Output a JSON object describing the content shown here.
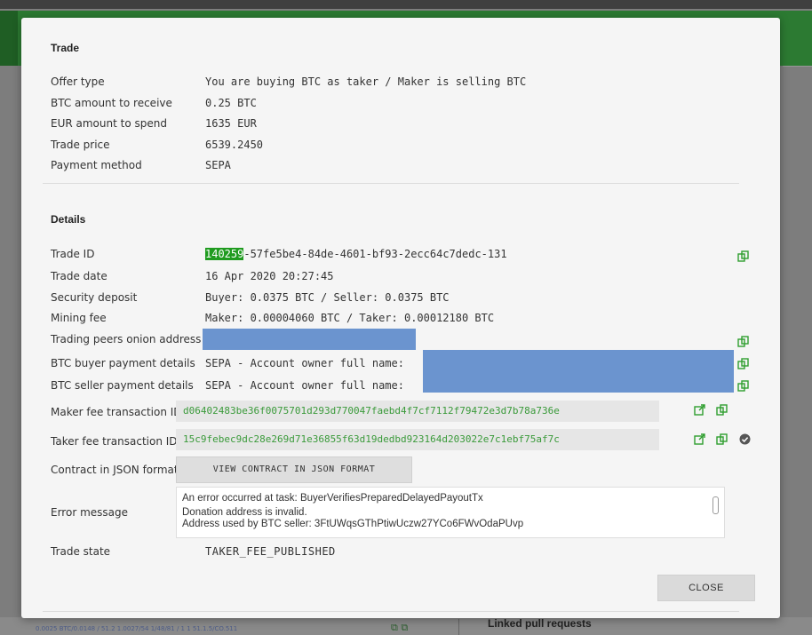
{
  "background": {
    "linked_label": "Linked pull requests",
    "bottom_text": "0.0025 BTC/0.0148 / 51.2 1.0027/54 1/48/81 / 1 1 51.1.5/CO.511"
  },
  "trade": {
    "title": "Trade",
    "rows": [
      {
        "label": "Offer type",
        "value": "You are buying BTC as taker / Maker is selling BTC"
      },
      {
        "label": "BTC amount to receive",
        "value": "0.25 BTC"
      },
      {
        "label": "EUR amount to spend",
        "value": "1635 EUR"
      },
      {
        "label": "Trade price",
        "value": "6539.2450"
      },
      {
        "label": "Payment method",
        "value": "SEPA"
      }
    ]
  },
  "details": {
    "title": "Details",
    "trade_id_label": "Trade ID",
    "trade_id_highlight": "140259",
    "trade_id_rest": "-57fe5be4-84de-4601-bf93-2ecc64c7dedc-131",
    "trade_date_label": "Trade date",
    "trade_date": "16 Apr 2020 20:27:45",
    "security_deposit_label": "Security deposit",
    "security_deposit": "Buyer: 0.0375 BTC / Seller: 0.0375 BTC",
    "mining_fee_label": "Mining fee",
    "mining_fee": "Maker: 0.00004060 BTC / Taker: 0.00012180 BTC",
    "onion_label": "Trading peers onion address",
    "buyer_payment_label": "BTC buyer payment details",
    "buyer_payment_value": "SEPA - Account owner full name:",
    "seller_payment_label": "BTC seller payment details",
    "seller_payment_value": "SEPA - Account owner full name:",
    "maker_fee_label": "Maker fee transaction ID",
    "maker_fee_txid": "d06402483be36f0075701d293d770047faebd4f7cf7112f79472e3d7b78a736e",
    "taker_fee_label": "Taker fee transaction ID",
    "taker_fee_txid": "15c9febec9dc28e269d71e36855f63d19dedbd923164d203022e7c1ebf75af7c",
    "contract_label": "Contract in JSON format",
    "contract_button": "VIEW CONTRACT IN JSON FORMAT",
    "error_label": "Error message",
    "error_line1": "An error occurred at task: BuyerVerifiesPreparedDelayedPayoutTx",
    "error_line2": "Donation address is invalid.",
    "error_line3": "Address used by BTC seller: 3FtUWqsGThPtiwUczw27YCo6FWvOdaPUvp",
    "trade_state_label": "Trade state",
    "trade_state": "TAKER_FEE_PUBLISHED"
  },
  "close_button": "CLOSE",
  "colors": {
    "accent_green": "#1f9b1f",
    "txid_green": "#3a9a3a",
    "redaction_blue": "#6b94cf",
    "icon_green": "#2e9e2e"
  }
}
